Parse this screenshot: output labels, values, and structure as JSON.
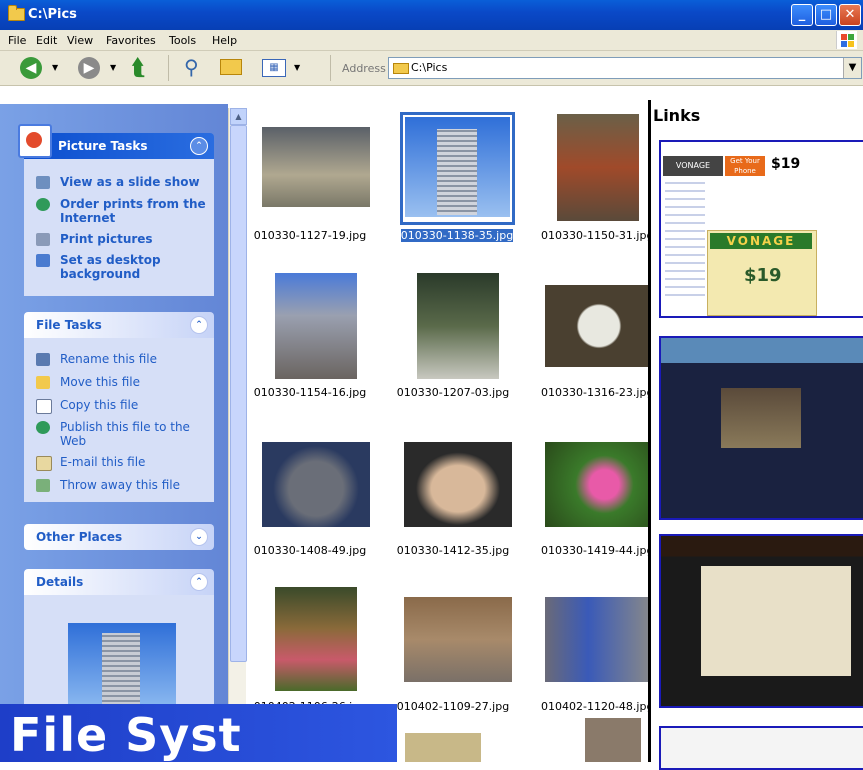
{
  "window": {
    "title": "C:\\Pics",
    "controls": [
      "minimize",
      "maximize",
      "close"
    ]
  },
  "menu": [
    "File",
    "Edit",
    "View",
    "Favorites",
    "Tools",
    "Help"
  ],
  "toolbar": {
    "address_label": "Address",
    "address_value": "C:\\Pics"
  },
  "task_pane": {
    "picture_tasks": {
      "title": "Picture Tasks",
      "items": [
        "View as a slide show",
        "Order prints from the Internet",
        "Print pictures",
        "Set as desktop background"
      ]
    },
    "file_tasks": {
      "title": "File Tasks",
      "items": [
        "Rename this file",
        "Move this file",
        "Copy this file",
        "Publish this file to the Web",
        "E-mail this file",
        "Throw away this file"
      ]
    },
    "other_places": {
      "title": "Other Places"
    },
    "details": {
      "title": "Details"
    }
  },
  "files": [
    "010330-1127-19.jpg",
    "010330-1138-35.jpg",
    "010330-1150-31.jpg",
    "010330-1154-16.jpg",
    "010330-1207-03.jpg",
    "010330-1316-23.jpg",
    "010330-1408-49.jpg",
    "010330-1412-35.jpg",
    "010330-1419-44.jpg",
    "010402-1106-26.jpg",
    "010402-1109-27.jpg",
    "010402-1120-48.jpg"
  ],
  "selected_file": "010330-1138-35.jpg",
  "links_pane": {
    "title": "Links",
    "ad": {
      "brand": "VONAGE",
      "price": "$19",
      "tag": "Get Your Phone"
    }
  },
  "banner": {
    "text": "File Syst"
  },
  "colors": {
    "selection": "#316ac5",
    "task_link": "#215dc6",
    "title_bar": "#0a49c8"
  }
}
